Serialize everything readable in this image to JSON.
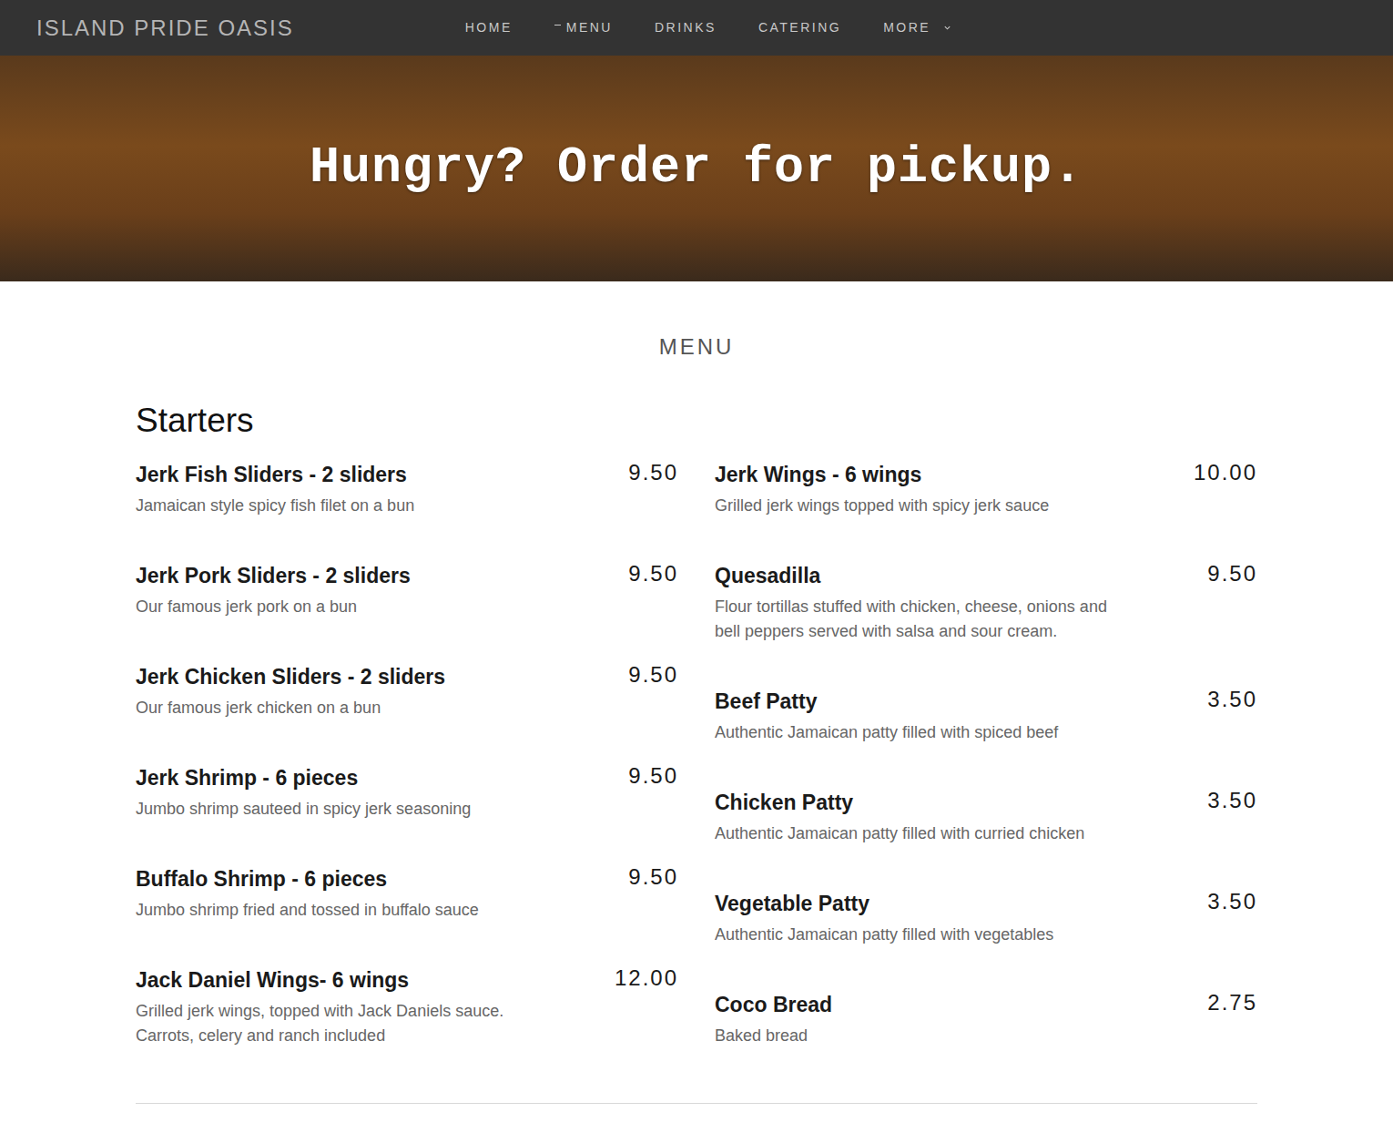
{
  "brand": "ISLAND PRIDE OASIS",
  "nav": [
    {
      "label": "HOME",
      "selected": false,
      "kind": "link"
    },
    {
      "label": "MENU",
      "selected": true,
      "kind": "link"
    },
    {
      "label": "DRINKS",
      "selected": false,
      "kind": "link"
    },
    {
      "label": "CATERING",
      "selected": false,
      "kind": "link"
    },
    {
      "label": "MORE",
      "selected": false,
      "kind": "dropdown"
    }
  ],
  "hero": {
    "title": "Hungry? Order for pickup."
  },
  "menu": {
    "title": "MENU",
    "category": "Starters",
    "columns": [
      [
        {
          "name": "Jerk Fish Sliders - 2 sliders",
          "price": "9.50",
          "description": "Jamaican style spicy fish filet on a bun"
        },
        {
          "name": "Jerk Pork Sliders - 2 sliders",
          "price": "9.50",
          "description": "Our famous jerk pork on a bun"
        },
        {
          "name": "Jerk Chicken Sliders - 2 sliders",
          "price": "9.50",
          "description": "Our famous jerk chicken on a bun"
        },
        {
          "name": "Jerk Shrimp - 6 pieces",
          "price": "9.50",
          "description": "Jumbo shrimp sauteed in spicy jerk seasoning"
        },
        {
          "name": "Buffalo Shrimp - 6 pieces",
          "price": "9.50",
          "description": "Jumbo shrimp fried and tossed in buffalo sauce"
        },
        {
          "name": "Jack Daniel Wings- 6 wings",
          "price": "12.00",
          "description": "Grilled jerk wings, topped with Jack Daniels sauce. Carrots, celery and ranch included"
        }
      ],
      [
        {
          "name": "Jerk Wings - 6 wings",
          "price": "10.00",
          "description": "Grilled jerk wings topped with spicy jerk sauce"
        },
        {
          "name": "Quesadilla",
          "price": "9.50",
          "description": "Flour tortillas stuffed with chicken, cheese, onions and bell peppers served with salsa and sour cream."
        },
        {
          "name": "Beef Patty",
          "price": "3.50",
          "description": "Authentic Jamaican patty filled with spiced beef"
        },
        {
          "name": "Chicken Patty",
          "price": "3.50",
          "description": "Authentic Jamaican patty filled with curried chicken"
        },
        {
          "name": "Vegetable Patty",
          "price": "3.50",
          "description": "Authentic Jamaican patty filled with vegetables"
        },
        {
          "name": "Coco Bread",
          "price": "2.75",
          "description": "Baked bread"
        }
      ]
    ]
  }
}
